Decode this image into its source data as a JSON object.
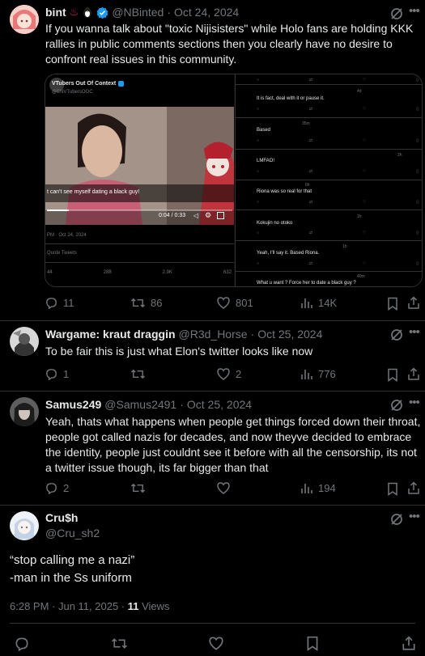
{
  "post1": {
    "name": "bint",
    "handle": "@NBinted",
    "date": "Oct 24, 2024",
    "text": "If you wanna talk about \"toxic Nijisisters\" while Holo fans are holding KKK rallies in public comments sections then you clearly have no desire to confront real issues in this community.",
    "replies": "11",
    "reposts": "86",
    "likes": "801",
    "views": "14K",
    "media": {
      "quoted_name": "VTubers Out Of Context",
      "quoted_handle": "@ENVTubersOOC",
      "subtitle": "t can't see myself dating a black guy!",
      "time": "0:04 / 0:33",
      "date_line": "PM · Oct 24, 2024",
      "quote_tweets": "Quote Tweets",
      "stats": [
        "44",
        "288",
        "2.9K",
        "632"
      ],
      "comments": [
        {
          "time": "4d",
          "text": "It is fact, deal with it or pause it."
        },
        {
          "time": "35m",
          "text": "Based"
        },
        {
          "time": "2h",
          "text": "LMFAO!"
        },
        {
          "time": "6h",
          "text": "Riona was so real for that"
        },
        {
          "time": "1h",
          "text": "Kokujin no otoko"
        },
        {
          "time": "1h",
          "text": "Yeah, I'll say it. Based Riona."
        },
        {
          "time": "40m",
          "text": "What u want ? Force her to date a black guy ?"
        }
      ]
    }
  },
  "post2": {
    "name": "Wargame: kraut draggin",
    "handle": "@R3d_Horse",
    "date": "Oct 25, 2024",
    "text": "To be fair this is just what Elon's twitter looks like now",
    "replies": "1",
    "likes": "2",
    "views": "776"
  },
  "post3": {
    "name": "Samus249",
    "handle": "@Samus2491",
    "date": "Oct 25, 2024",
    "text": "Yeah, thats what happens when people get things forced down their throat, people got called nazis for decades, and now theyve decided to embrace the identity, people just couldnt see it before with all the censorship, its not a twitter issue though, its far bigger than that",
    "replies": "2",
    "views": "194"
  },
  "post4": {
    "name": "Cru$h",
    "handle": "@Cru_sh2",
    "line1": "“stop calling me a nazi”",
    "line2": "-man in the Ss uniform",
    "timestamp": "6:28 PM · Jun 11, 2025 · ",
    "views_count": "11",
    "views_label": " Views"
  },
  "colors": {
    "background": "#000000",
    "text": "#e7e9ea",
    "muted": "#71767b",
    "divider": "#2f3336",
    "verified": "#1d9bf0"
  }
}
